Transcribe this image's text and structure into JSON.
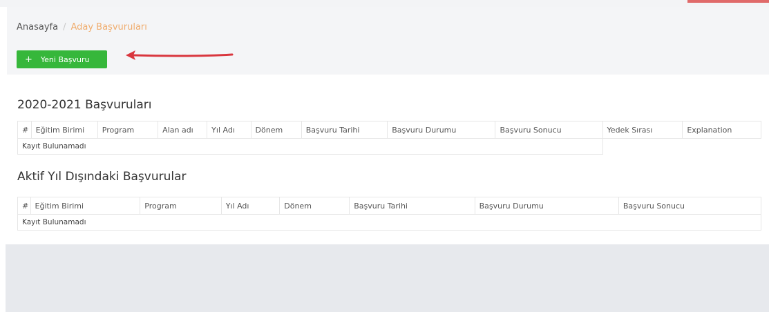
{
  "breadcrumb": {
    "home": "Anasayfa",
    "separator": "/",
    "current": "Aday Başvuruları"
  },
  "new_button": {
    "icon": "plus-icon",
    "label": "Yeni Başvuru"
  },
  "colors": {
    "button_green": "#36b73b",
    "arrow_red": "#d9363e",
    "breadcrumb_active": "#f0ad6e"
  },
  "section1": {
    "title": "2020-2021 Başvuruları",
    "columns": [
      "#",
      "Eğitim Birimi",
      "Program",
      "Alan adı",
      "Yıl Adı",
      "Dönem",
      "Başvuru Tarihi",
      "Başvuru Durumu",
      "Başvuru Sonucu",
      "Yedek Sırası",
      "Explanation"
    ],
    "empty_text": "Kayıt Bulunamadı"
  },
  "section2": {
    "title": "Aktif Yıl Dışındaki Başvurular",
    "columns": [
      "#",
      "Eğitim Birimi",
      "Program",
      "Yıl Adı",
      "Dönem",
      "Başvuru Tarihi",
      "Başvuru Durumu",
      "Başvuru Sonucu"
    ],
    "empty_text": "Kayıt Bulunamadı"
  }
}
